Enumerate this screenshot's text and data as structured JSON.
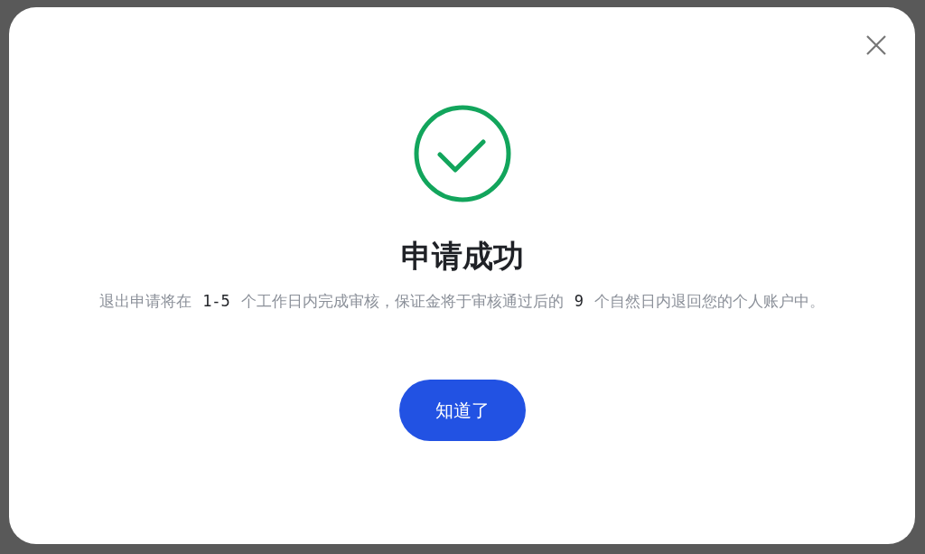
{
  "dialog": {
    "title": "申请成功",
    "message": [
      {
        "kind": "text",
        "text": "退出申请将在"
      },
      {
        "kind": "number",
        "text": "1-5"
      },
      {
        "kind": "text",
        "text": "个工作日内完成审核，保证金将于审核通过后的"
      },
      {
        "kind": "number",
        "text": "9"
      },
      {
        "kind": "text",
        "text": "个自然日内退回您的个人账户中。"
      }
    ],
    "button": "知道了"
  }
}
